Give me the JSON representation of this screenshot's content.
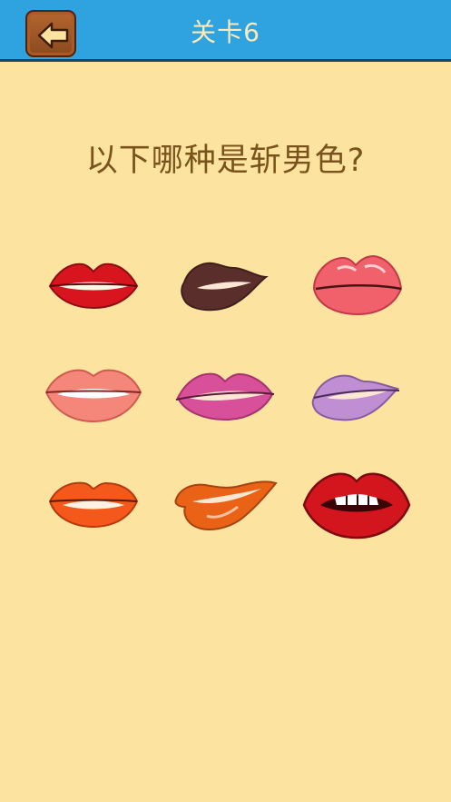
{
  "header": {
    "title": "关卡6",
    "back_icon": "left-arrow-icon",
    "bar_color": "#2ea3e0"
  },
  "question": "以下哪种是斩男色?",
  "options": [
    {
      "id": "lip-1",
      "color": "#d8141e",
      "dark": "#8e0d12",
      "style": "thin"
    },
    {
      "id": "lip-2",
      "color": "#5a2f2b",
      "dark": "#3e1f1c",
      "style": "side"
    },
    {
      "id": "lip-3",
      "color": "#f0616c",
      "dark": "#c03a47",
      "style": "pucker"
    },
    {
      "id": "lip-4",
      "color": "#f48779",
      "dark": "#d05a50",
      "style": "full"
    },
    {
      "id": "lip-5",
      "color": "#d8509a",
      "dark": "#a8316e",
      "style": "thin"
    },
    {
      "id": "lip-6",
      "color": "#c08ed2",
      "dark": "#8a5aa0",
      "style": "side"
    },
    {
      "id": "lip-7",
      "color": "#f4581b",
      "dark": "#b53a0d",
      "style": "full"
    },
    {
      "id": "lip-8",
      "color": "#ea6216",
      "dark": "#a64210",
      "style": "side"
    },
    {
      "id": "lip-9",
      "color": "#d3161e",
      "dark": "#7d0a0f",
      "style": "open"
    }
  ]
}
